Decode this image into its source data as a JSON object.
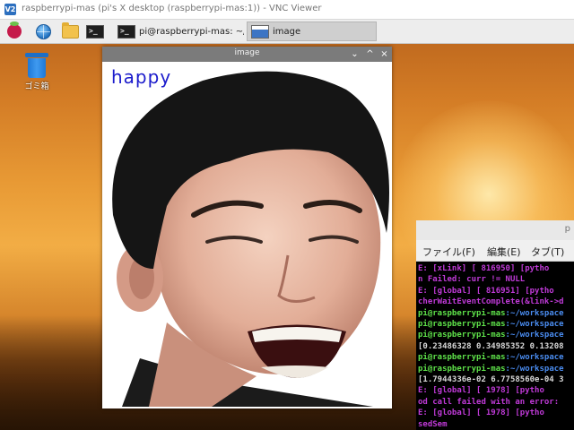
{
  "vnc": {
    "logo": "V2",
    "title": "raspberrypi-mas (pi's X desktop (raspberrypi-mas:1)) - VNC Viewer"
  },
  "taskbar": {
    "launchers": [
      {
        "icon": "raspberry-menu-icon"
      },
      {
        "icon": "web-browser-icon"
      },
      {
        "icon": "file-manager-icon"
      },
      {
        "icon": "terminal-icon",
        "glyph": ">_"
      }
    ],
    "tasks": [
      {
        "label": "pi@raspberrypi-mas: ~/wo...",
        "icon": "terminal-icon",
        "glyph": ">_",
        "active": false
      },
      {
        "label": "image",
        "icon": "image-window-icon",
        "active": true
      }
    ]
  },
  "desktop": {
    "trash_label": "ゴミ箱"
  },
  "image_window": {
    "title": "image",
    "controls": [
      "⌄",
      "^",
      "×"
    ],
    "overlay_label": "happy",
    "overlay_color": "#1c1ccc"
  },
  "terminal": {
    "title_fragment": "p",
    "menu": [
      "ファイル(F)",
      "編集(E)",
      "タブ(T)"
    ],
    "lines": [
      {
        "type": "err",
        "text": "E: [xLink] [    816950] [pytho"
      },
      {
        "type": "err",
        "text": "n Failed: curr != NULL"
      },
      {
        "type": "err",
        "text": "E: [global] [    816951] [pytho"
      },
      {
        "type": "err",
        "text": "cherWaitEventComplete(&link->d"
      },
      {
        "type": "prompt",
        "user": "pi@raspberrypi-mas",
        "path": ":~/workspace"
      },
      {
        "type": "prompt",
        "user": "pi@raspberrypi-mas",
        "path": ":~/workspace"
      },
      {
        "type": "prompt",
        "user": "pi@raspberrypi-mas",
        "path": ":~/workspace"
      },
      {
        "type": "plain",
        "text": "[0.23486328 0.34985352 0.13208"
      },
      {
        "type": "prompt",
        "user": "pi@raspberrypi-mas",
        "path": ":~/workspace"
      },
      {
        "type": "prompt",
        "user": "pi@raspberrypi-mas",
        "path": ":~/workspace"
      },
      {
        "type": "plain",
        "text": "[1.7944336e-02 6.7758560e-04 3"
      },
      {
        "type": "err",
        "text": "E: [global] [      1978] [pytho"
      },
      {
        "type": "err",
        "text": "od call failed with an error:"
      },
      {
        "type": "err",
        "text": "E: [global] [      1978] [pytho"
      },
      {
        "type": "err",
        "text": "sedSem"
      }
    ]
  },
  "colors": {
    "terminal_error": "#c03ad8",
    "terminal_prompt": "#5fe34a",
    "terminal_path": "#4a8cf0",
    "taskbar_bg": "#ededed",
    "image_titlebar": "#7b7b7b"
  }
}
